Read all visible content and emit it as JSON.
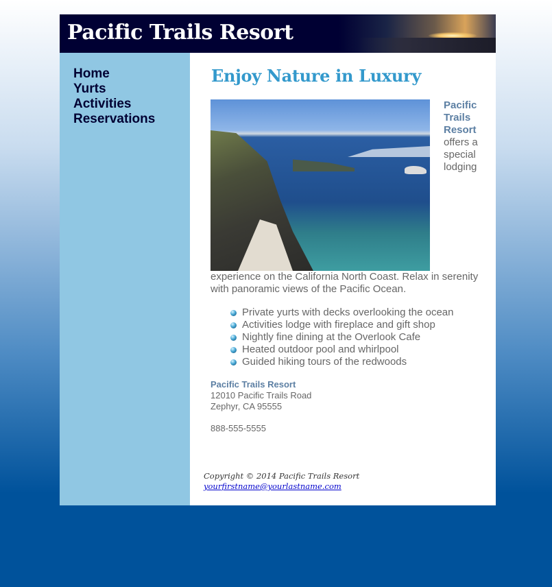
{
  "site": {
    "title": "Pacific Trails Resort"
  },
  "nav": {
    "items": [
      {
        "label": "Home"
      },
      {
        "label": "Yurts"
      },
      {
        "label": "Activities"
      },
      {
        "label": "Reservations"
      }
    ]
  },
  "main": {
    "heading": "Enjoy Nature in Luxury",
    "intro": {
      "brand": "Pacific Trails Resort",
      "text": "offers a special lodging experience on the California North Coast. Relax in serenity with panoramic views of the Pacific Ocean."
    },
    "features": [
      "Private yurts with decks overlooking the ocean",
      "Activities lodge with fireplace and gift shop",
      "Nightly fine dining at the Overlook Cafe",
      "Heated outdoor pool and whirlpool",
      "Guided hiking tours of the redwoods"
    ],
    "contact": {
      "name": "Pacific Trails Resort",
      "street": "12010 Pacific Trails Road",
      "city": "Zephyr, CA 95555",
      "phone": "888-555-5555"
    }
  },
  "footer": {
    "copyright": "Copyright © 2014 Pacific Trails Resort",
    "email": "yourfirstname@yourlastname.com"
  },
  "icons": {
    "bullet": "blue-sphere-bullet-icon"
  },
  "colors": {
    "header_bg": "#000033",
    "nav_bg": "#90c7e3",
    "heading": "#3399cc",
    "brand_text": "#5c7fa3",
    "body_text": "#666666"
  }
}
